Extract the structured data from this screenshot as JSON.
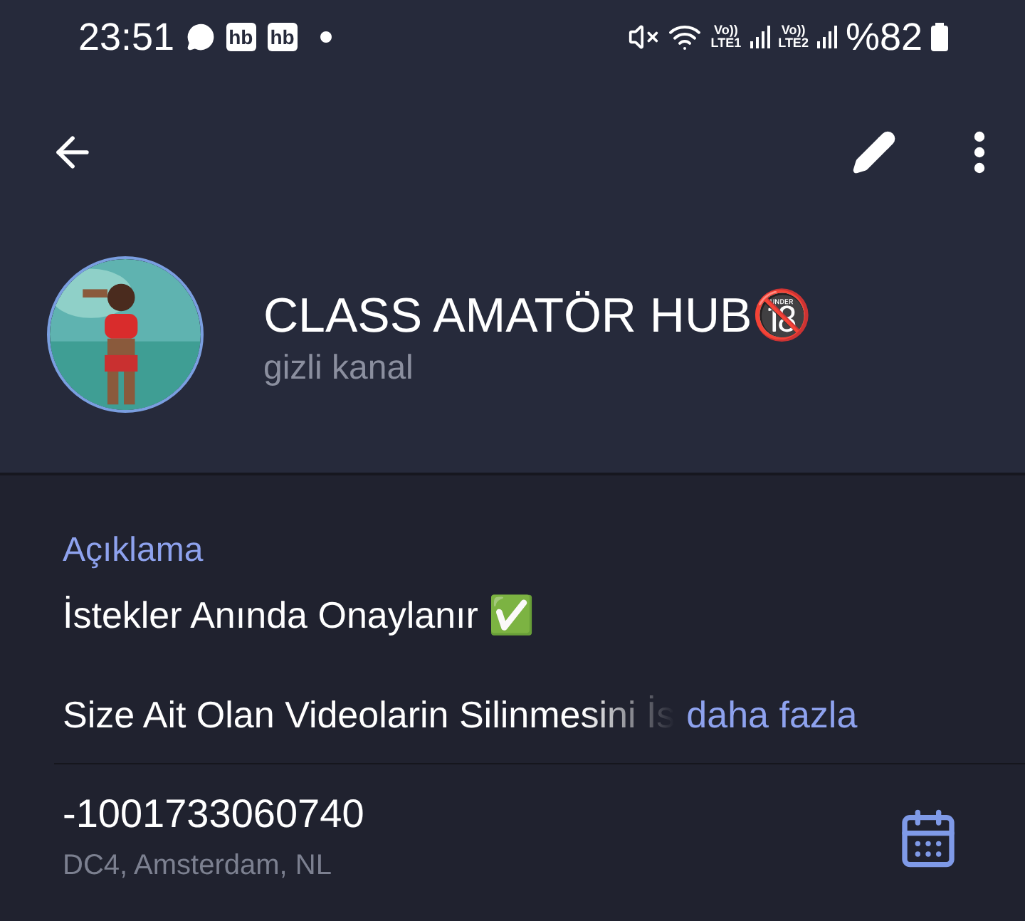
{
  "status_bar": {
    "time": "23:51",
    "badges": [
      "hb",
      "hb"
    ],
    "sim1": {
      "top": "Vo))",
      "bottom": "LTE1"
    },
    "sim2": {
      "top": "Vo))",
      "bottom": "LTE2"
    },
    "battery": "%82"
  },
  "channel": {
    "title": "CLASS AMATÖR HUB🔞",
    "subtitle": "gizli kanal"
  },
  "description": {
    "heading": "Açıklama",
    "lines": [
      "İstekler Anında Onaylanır ✅"
    ],
    "truncated_line": "Size Ait Olan Videolarin Silinmesini İs",
    "more_link": "daha fazla"
  },
  "info": {
    "id": "-1001733060740",
    "location": "DC4, Amsterdam, NL"
  }
}
